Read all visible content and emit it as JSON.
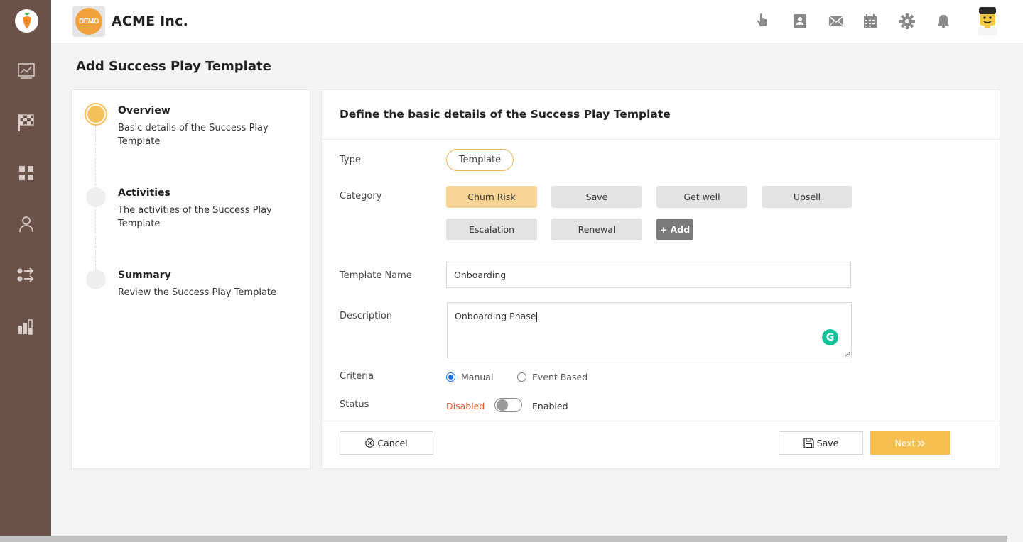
{
  "app": {
    "brand_badge": "DEMO",
    "company_name": "ACME Inc."
  },
  "sidebar": {
    "items": [
      {
        "icon": "analytics-chart-icon"
      },
      {
        "icon": "checkered-flag-icon"
      },
      {
        "icon": "dashboard-grid-icon"
      },
      {
        "icon": "user-icon"
      },
      {
        "icon": "workflow-icon"
      },
      {
        "icon": "bar-chart-icon"
      }
    ],
    "accent_color": "#6b5248"
  },
  "topbar": {
    "icons": [
      "touch-pointer-icon",
      "contacts-book-icon",
      "mail-icon",
      "calendar-icon",
      "gear-icon",
      "bell-icon"
    ]
  },
  "page": {
    "title": "Add Success Play Template"
  },
  "stepper": {
    "steps": [
      {
        "title": "Overview",
        "description": "Basic details of the Success Play Template",
        "active": true
      },
      {
        "title": "Activities",
        "description": "The activities of the Success Play Template",
        "active": false
      },
      {
        "title": "Summary",
        "description": "Review the Success Play Template",
        "active": false
      }
    ]
  },
  "form": {
    "heading": "Define the basic details of the Success Play Template",
    "type": {
      "label": "Type",
      "value": "Template"
    },
    "category": {
      "label": "Category",
      "options": [
        "Churn Risk",
        "Save",
        "Get well",
        "Upsell",
        "Escalation",
        "Renewal"
      ],
      "selected": "Churn Risk",
      "add_label": "+ Add"
    },
    "template_name": {
      "label": "Template Name",
      "value": "Onboarding"
    },
    "description": {
      "label": "Description",
      "value": "Onboarding Phase"
    },
    "criteria": {
      "label": "Criteria",
      "options": [
        "Manual",
        "Event Based"
      ],
      "selected": "Manual"
    },
    "status": {
      "label": "Status",
      "off_label": "Disabled",
      "on_label": "Enabled",
      "enabled": false
    },
    "buttons": {
      "cancel": "Cancel",
      "save": "Save",
      "next": "Next"
    }
  },
  "colors": {
    "primary": "#f7bf4f",
    "selected_category": "#f8d496",
    "disabled_text": "#e55a2b",
    "radio_checked": "#1a73e8"
  }
}
